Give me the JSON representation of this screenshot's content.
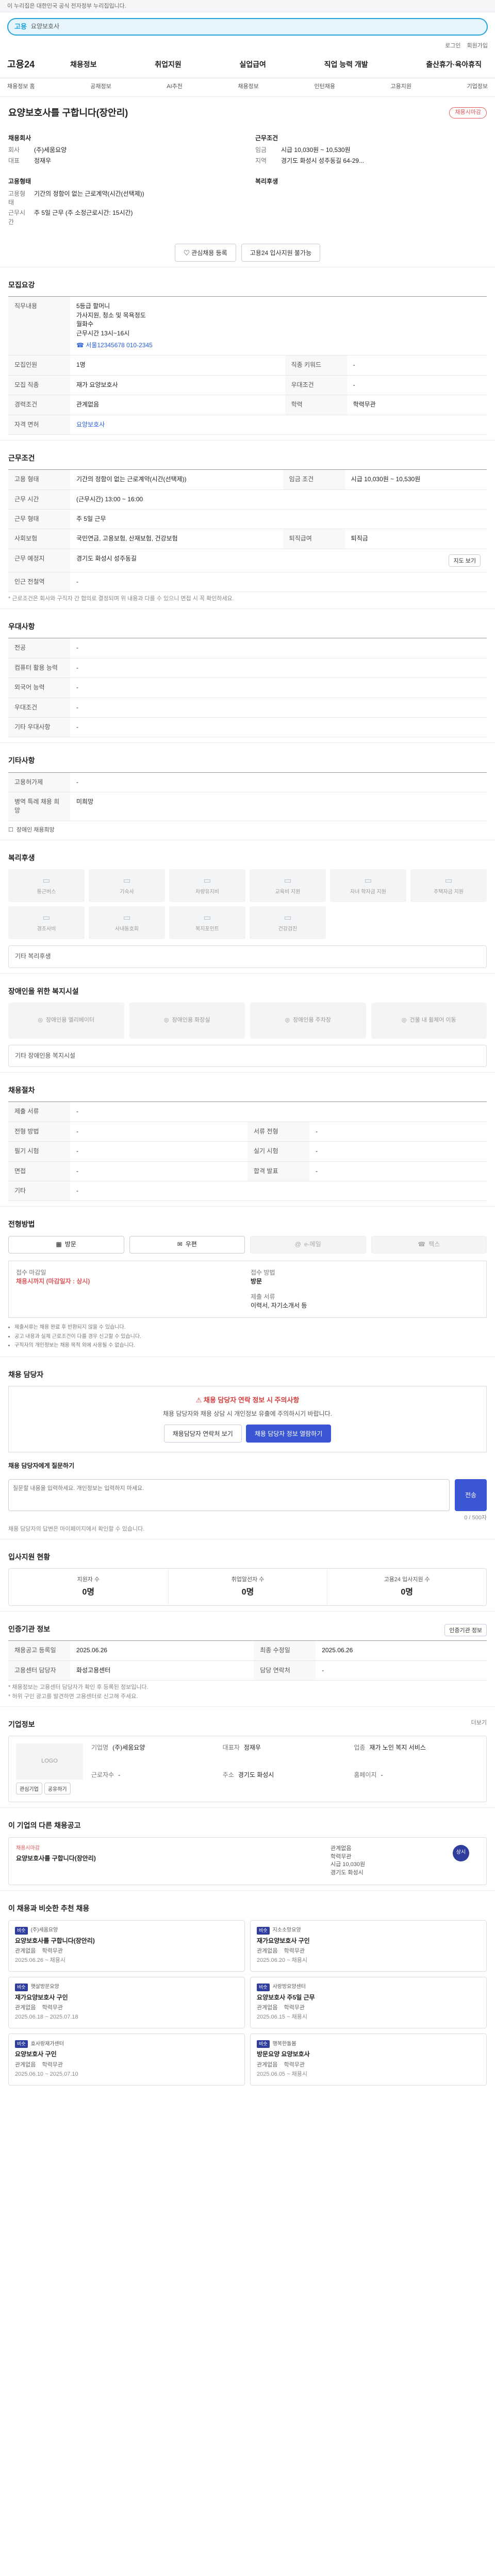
{
  "banner": "이 누리집은 대한민국 공식 전자정부 누리집입니다.",
  "search": {
    "label": "고용",
    "query": "요양보호사"
  },
  "util_links": [
    "로그인",
    "회원가입"
  ],
  "logo": "고용24",
  "gnb": [
    "채용정보",
    "취업지원",
    "실업급여",
    "직업 능력 개발",
    "출산휴가·육아휴직"
  ],
  "snb": [
    "채용정보 홈",
    "공채정보",
    "AI추천",
    "채용정보",
    "인턴채용",
    "고용지원",
    "기업정보"
  ],
  "job": {
    "title": "요양보호사를 구합니다(장안리)",
    "deadline_badge": "채용시마감",
    "company_head": "채용회사",
    "company_name_k": "회사",
    "company_name": "(주)세움요양",
    "company_ceo_k": "대표",
    "company_ceo": "정재우",
    "work_head": "근무조건",
    "pay_k": "임금",
    "pay": "시급 10,030원 ~ 10,530원",
    "place_k": "지역",
    "place": "경기도 화성시 성주동길 64-29...",
    "type_head": "고용형태",
    "type_k": "고용형태",
    "type": "기간의 정함이 없는 근로계약(시간(선택제))",
    "hours_k": "근무시간",
    "hours": "주 5일 근무 (주 소정근로시간: 15시간)",
    "welfare_head": "복리후생",
    "btn_save": "관심채용 등록",
    "btn_share": "고용24 입사지원 불가능"
  },
  "recruit": {
    "title": "모집요강",
    "duty_k": "직무내용",
    "duty": "5등급 할머니\n가사지원, 청소 및 목욕정도\n월화수\n근무시간 13시~16시",
    "duty_tel": "☎ 서울12345678 010-2345",
    "count_k": "모집인원",
    "count": "1명",
    "career_k": "경력조건",
    "career": "관계없음",
    "edu_k": "학력",
    "edu": "학력무관",
    "require_k": "모집 직종",
    "require": "재가 요양보호사",
    "license_k": "자격 면허",
    "license": "요양보호사",
    "major_k": "직종 키워드",
    "major": "-",
    "etc_k": "우대조건",
    "etc": "-"
  },
  "work": {
    "title": "근무조건",
    "type_k": "고용 형태",
    "type": "기간의 정함이 없는 근로계약(시간(선택제))",
    "pay_k": "임금 조건",
    "pay": "시급 10,030원 ~ 10,530원",
    "place_k": "근무 예정지",
    "place": "경기도 화성시 성주동길 64-29\n근무시간은 협의에 가능하며 중대 방문상세 바람",
    "worktime_k": "근무 시간",
    "worktime": "(근무시간) 13:00 ~ 16:00",
    "days_k": "근무 형태",
    "days": "주 5일 근무",
    "insurance_k": "사회보험",
    "insurance": "국민연금, 고용보험, 산재보험, 건강보험",
    "retire_k": "퇴직급여",
    "retire": "퇴직금",
    "addr_k": "근무 예정지",
    "addr": "경기도 화성시 성주동길",
    "map_btn": "지도 보기",
    "transport_k": "인근 전철역",
    "transport": "-",
    "note": "* 근로조건은 회사와 구직자 간 협의로 결정되며 위 내용과 다를 수 있으니 면접 시 꼭 확인하세요."
  },
  "prefs": {
    "title": "우대사항",
    "rows": [
      {
        "k": "전공",
        "v": "-"
      },
      {
        "k": "컴퓨터 활용 능력",
        "v": "-"
      },
      {
        "k": "외국어 능력",
        "v": "-"
      },
      {
        "k": "우대조건",
        "v": "-"
      },
      {
        "k": "기타 우대사항",
        "v": "-"
      }
    ]
  },
  "misc": {
    "title": "기타사항",
    "rows": [
      {
        "k": "고용허가제",
        "v": "-"
      },
      {
        "k": "병역 특례 채용 희망",
        "v": "미희망"
      }
    ],
    "checkbox": "장애인 채용희망"
  },
  "welfare": {
    "title": "복리후생",
    "items": [
      "통근버스",
      "기숙사",
      "차량유지비",
      "교육비 지원",
      "자녀 학자금 지원",
      "주택자금 지원",
      "경조사비",
      "사내동호회",
      "복지포인트",
      "건강검진"
    ],
    "etc_label": "기타 복리후생"
  },
  "facility": {
    "title": "장애인을 위한 복지시설",
    "items": [
      "장애인용 엘리베이터",
      "장애인용 화장실",
      "장애인용 주차장",
      "건물 내 휠체어 이동"
    ],
    "etc_label": "기타 장애인용 복지시설"
  },
  "process": {
    "title": "채용절차",
    "rows": [
      {
        "k": "제출 서류",
        "v": "-"
      },
      {
        "k": "전형 방법",
        "v": "-"
      },
      {
        "k": "서류 전형",
        "v": "-"
      },
      {
        "k": "필기 시험",
        "v": "-"
      },
      {
        "k": "실기 시험",
        "v": "-"
      },
      {
        "k": "면접",
        "v": "-"
      },
      {
        "k": "합격 발표",
        "v": "-"
      },
      {
        "k": "기타",
        "v": "-"
      }
    ]
  },
  "apply": {
    "title": "전형방법",
    "methods": [
      "방문",
      "우편",
      "e-메일",
      "팩스"
    ],
    "deadline_k": "접수 마감일",
    "deadline": "채용시까지 (마감일자 : 상시)",
    "doc_k": "접수 방법",
    "doc": "방문",
    "resume_k": "제출 서류",
    "resume": "이력서, 자기소개서 등",
    "notes": [
      "제출서류는 채용 완료 후 반환되지 않을 수 있습니다.",
      "공고 내용과 실제 근로조건이 다를 경우 신고할 수 있습니다.",
      "구직자의 개인정보는 채용 목적 외에 사용될 수 없습니다."
    ]
  },
  "contact": {
    "title": "채용 담당자",
    "warn_title": "채용 담당자 연락 정보 시 주의사항",
    "warn_body": "채용 담당자와 채용 상담 시 개인정보 유출에 주의하시기 바랍니다.",
    "btn1": "채용담당자 연락처 보기",
    "btn2": "채용 담당자 정보 열람하기",
    "inquiry_label": "채용 담당자에게 질문하기",
    "inquiry_placeholder": "질문할 내용을 입력하세요. 개인정보는 입력하지 마세요.",
    "inquiry_count": "0 / 500자",
    "send": "전송",
    "notes": [
      "채용 담당자의 답변은 마이페이지에서 확인할 수 있습니다."
    ]
  },
  "stats": {
    "title": "입사지원 현황",
    "items": [
      {
        "label": "지원자 수",
        "value": "0명"
      },
      {
        "label": "취업알선자 수",
        "value": "0명"
      },
      {
        "label": "고용24 입사지원 수",
        "value": "0명"
      }
    ]
  },
  "agency": {
    "title": "인증기관 정보",
    "btn": "인증기관 정보",
    "rows": [
      {
        "k": "채용공고 등록일",
        "v": "2025.06.26",
        "k2": "최종 수정일",
        "v2": "2025.06.26"
      },
      {
        "k": "고용센터 담당자",
        "v": "화성고용센터",
        "k2": "담당 연락처",
        "v2": "-"
      }
    ],
    "notes": [
      "* 채용정보는 고용센터 담당자가 확인 후 등록된 정보입니다.",
      "* 허위 구인 광고를 발견하면 고용센터로 신고해 주세요."
    ]
  },
  "company": {
    "title": "기업정보",
    "more": "더보기",
    "logo_label": "LOGO",
    "btn_follow": "관심기업",
    "btn_share": "공유하기",
    "info": [
      {
        "k": "기업명",
        "v": "(주)세움요양"
      },
      {
        "k": "대표자",
        "v": "정재우"
      },
      {
        "k": "업종",
        "v": "재가 노인 복지 서비스"
      },
      {
        "k": "근로자수",
        "v": "-"
      },
      {
        "k": "주소",
        "v": "경기도 화성시"
      },
      {
        "k": "홈페이지",
        "v": "-"
      }
    ]
  },
  "other_jobs": {
    "title": "이 기업의 다른 채용공고",
    "tag": "채용시마감",
    "job_title": "요양보호사를 구합니다(장안리)",
    "meta": [
      "관계없음",
      "학력무관",
      "시급 10,030원",
      "경기도 화성시"
    ],
    "dday": "상시"
  },
  "reco": {
    "title": "이 채용과 비슷한 추천 채용",
    "items": [
      {
        "co": "(주)세움요양",
        "chip": "비슷",
        "t": "요양보호사를 구합니다(장안리)",
        "m1": "관계없음",
        "m2": "학력무관",
        "d": "2025.06.26 ~ 채용시"
      },
      {
        "co": "지소소망요양",
        "chip": "비슷",
        "t": "재가요양보호사 구인",
        "m1": "관계없음",
        "m2": "학력무관",
        "d": "2025.06.20 ~ 채용시"
      },
      {
        "co": "햇살방문요양",
        "chip": "비슷",
        "t": "재가요양보호사 구인",
        "m1": "관계없음",
        "m2": "학력무관",
        "d": "2025.06.18 ~ 2025.07.18"
      },
      {
        "co": "사랑방요양센터",
        "chip": "비슷",
        "t": "요양보호사 주5일 근무",
        "m1": "관계없음",
        "m2": "학력무관",
        "d": "2025.06.15 ~ 채용시"
      },
      {
        "co": "효사랑재가센터",
        "chip": "비슷",
        "t": "요양보호사 구인",
        "m1": "관계없음",
        "m2": "학력무관",
        "d": "2025.06.10 ~ 2025.07.10"
      },
      {
        "co": "행복한돌봄",
        "chip": "비슷",
        "t": "방문요양 요양보호사",
        "m1": "관계없음",
        "m2": "학력무관",
        "d": "2025.06.05 ~ 채용시"
      }
    ]
  }
}
